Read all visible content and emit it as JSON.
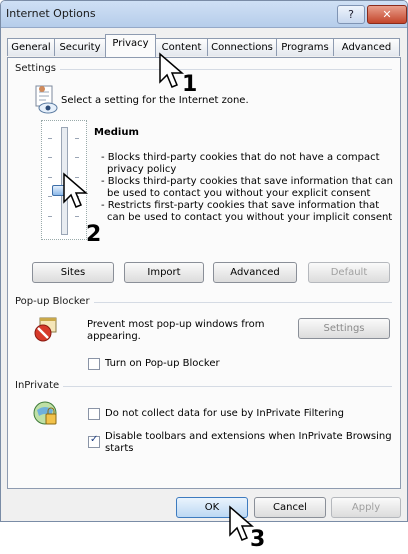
{
  "window": {
    "title": "Internet Options",
    "help_glyph": "?",
    "close_glyph": "✕"
  },
  "tabs": [
    {
      "label": "General"
    },
    {
      "label": "Security"
    },
    {
      "label": "Privacy",
      "active": true
    },
    {
      "label": "Content"
    },
    {
      "label": "Connections"
    },
    {
      "label": "Programs"
    },
    {
      "label": "Advanced"
    }
  ],
  "settings": {
    "group_label": "Settings",
    "intro": "Select a setting for the Internet zone.",
    "level_name": "Medium",
    "level_lines": [
      "- Blocks third-party cookies that do not have a compact",
      "privacy policy",
      "- Blocks third-party cookies that save information that can",
      "be used to contact you without your explicit consent",
      "- Restricts first-party cookies that save information that",
      "can be used to contact you without your implicit consent"
    ],
    "slider_level_fraction": 0.4
  },
  "buttons": {
    "sites": "Sites",
    "import": "Import",
    "advanced": "Advanced",
    "default": "Default"
  },
  "popup": {
    "group_label": "Pop-up Blocker",
    "text_line1": "Prevent most pop-up windows from",
    "text_line2": "appearing.",
    "settings_button": "Settings",
    "turn_on_label": "Turn on Pop-up Blocker",
    "turn_on_checked": false
  },
  "inprivate": {
    "group_label": "InPrivate",
    "filter_label": "Do not collect data for use by InPrivate Filtering",
    "filter_checked": false,
    "disable_label_line1": "Disable toolbars and extensions when InPrivate Browsing",
    "disable_label_line2": "starts",
    "disable_checked": true
  },
  "footer": {
    "ok": "OK",
    "cancel": "Cancel",
    "apply": "Apply"
  },
  "annotations": {
    "step1": "1",
    "step2": "2",
    "step3": "3"
  },
  "colors": {
    "accent": "#3d6ea8",
    "close": "#c3452b",
    "panel": "#fbfbfb"
  }
}
